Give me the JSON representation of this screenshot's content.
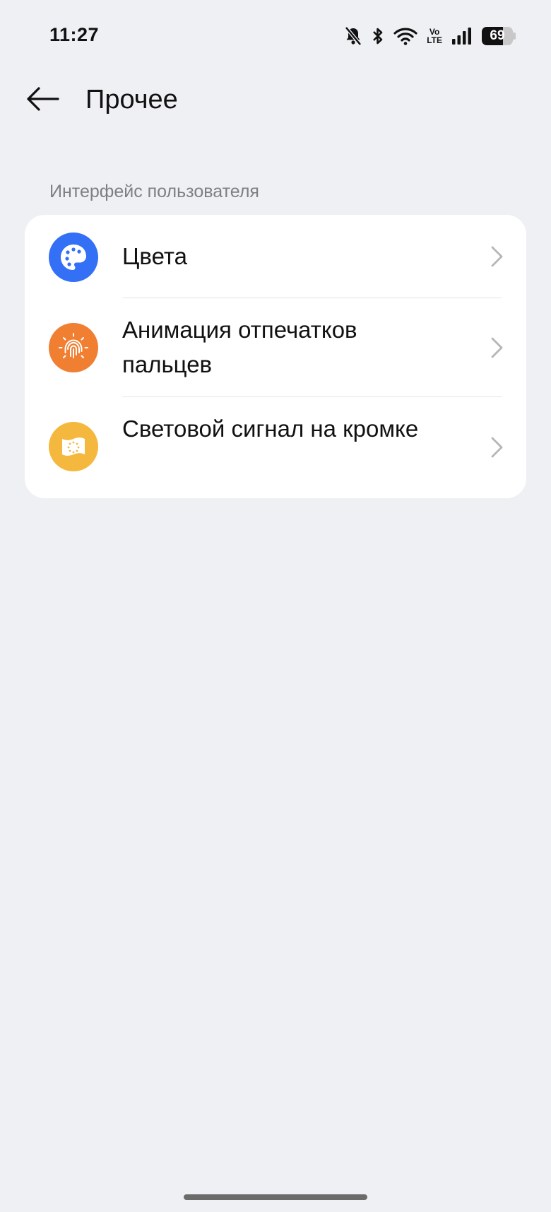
{
  "status_bar": {
    "time": "11:27",
    "volte_top": "Vo",
    "volte_bottom": "LTE",
    "battery_level": "69",
    "battery_fraction": 0.69,
    "icons": [
      "bell-muted-icon",
      "bluetooth-icon",
      "wifi-icon",
      "volte-icon",
      "signal-icon",
      "battery-icon"
    ]
  },
  "header": {
    "back_icon": "arrow-left-icon",
    "title": "Прочее"
  },
  "section": {
    "label": "Интерфейс пользователя",
    "items": [
      {
        "label": "Цвета",
        "icon": "palette-icon",
        "color": "#3470f5"
      },
      {
        "label": "Анимация отпечатков пальцев",
        "icon": "fingerprint-icon",
        "color": "#f07f32"
      },
      {
        "label": "Световой сигнал на кромке",
        "icon": "edge-light-icon",
        "color": "#f5b83f"
      }
    ]
  },
  "colors": {
    "background": "#eff0f3",
    "card": "#ffffff",
    "section_label": "#7d7f85",
    "chevron": "#b5b6ba"
  }
}
